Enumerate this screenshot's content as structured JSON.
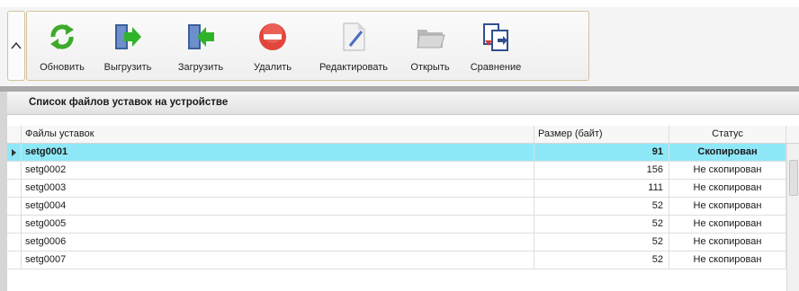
{
  "toolbar": {
    "buttons": [
      {
        "label": "Обновить",
        "icon": "refresh-icon"
      },
      {
        "label": "Выгрузить",
        "icon": "upload-icon"
      },
      {
        "label": "Загрузить",
        "icon": "download-icon"
      },
      {
        "label": "Удалить",
        "icon": "delete-icon"
      },
      {
        "label": "Редактировать",
        "icon": "edit-icon"
      },
      {
        "label": "Открыть",
        "icon": "open-folder-icon"
      },
      {
        "label": "Сравнение",
        "icon": "compare-icon"
      }
    ]
  },
  "panel": {
    "title": "Список файлов уставок на устройстве"
  },
  "table": {
    "columns": [
      "Файлы уставок",
      "Размер (байт)",
      "Статус"
    ],
    "rows": [
      {
        "name": "setg0001",
        "size": "91",
        "status": "Скопирован",
        "selected": true
      },
      {
        "name": "setg0002",
        "size": "156",
        "status": "Не скопирован"
      },
      {
        "name": "setg0003",
        "size": "111",
        "status": "Не скопирован"
      },
      {
        "name": "setg0004",
        "size": "52",
        "status": "Не скопирован"
      },
      {
        "name": "setg0005",
        "size": "52",
        "status": "Не скопирован"
      },
      {
        "name": "setg0006",
        "size": "52",
        "status": "Не скопирован"
      },
      {
        "name": "setg0007",
        "size": "52",
        "status": "Не скопирован"
      }
    ]
  },
  "colors": {
    "selected_row": "#8ee8f8",
    "toolbar_border": "#d2c39a"
  }
}
